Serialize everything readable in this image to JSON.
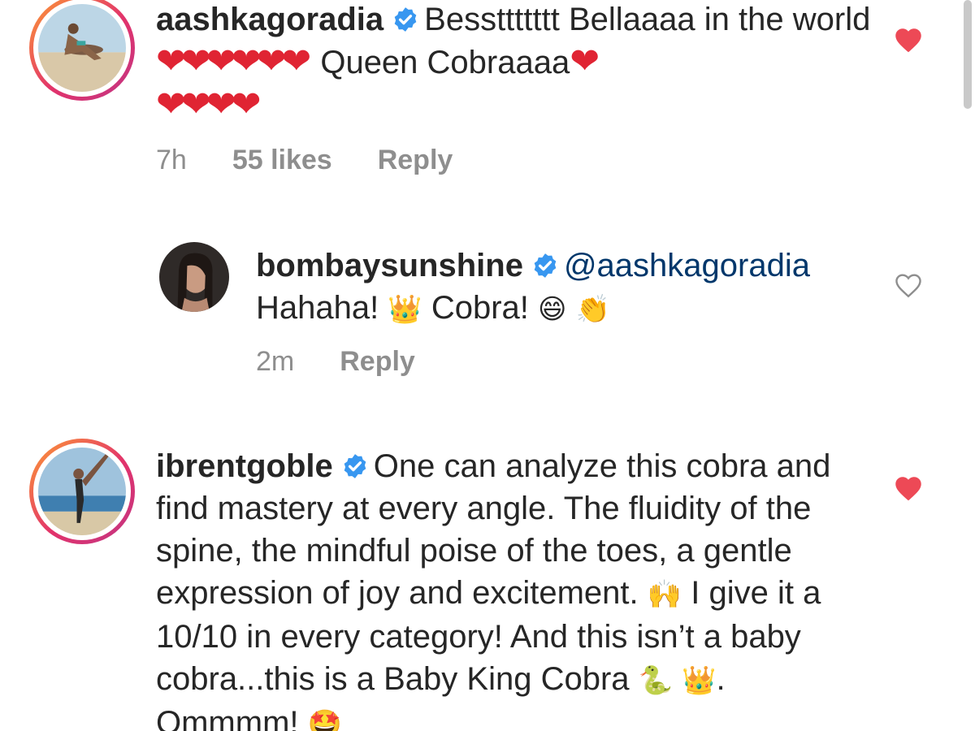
{
  "comments": [
    {
      "username": "aashkagoradia",
      "text_part1": "Bessttttttt Bellaaaa in the world",
      "hearts_a": "❤❤❤❤❤❤",
      "text_part2": "Queen Cobraaaa",
      "hearts_b": "❤",
      "hearts_c": "❤❤❤❤",
      "time": "7h",
      "likes": "55 likes",
      "reply": "Reply",
      "liked": true
    },
    {
      "username": "bombaysunshine",
      "mention": "@aashkagoradia",
      "text_part1": "Hahaha!",
      "emoji_crown": "👑",
      "text_part2": "Cobra!",
      "emoji_grin": "😄",
      "emoji_clap": "👏",
      "time": "2m",
      "reply": "Reply",
      "liked": false
    },
    {
      "username": "ibrentgoble",
      "text_part1": "One can analyze this cobra and find mastery at every angle. The fluidity of the spine, the mindful poise of the toes, a gentle expression of joy and excitement.",
      "emoji_hands": "🙌",
      "text_part2": "I give it a 10/10 in every category! And this isn’t a baby cobra...this is a Baby King Cobra",
      "emoji_snake": "🐍",
      "emoji_crown": "👑",
      "text_part3": ". Ommmm!",
      "emoji_starstruck": "🤩",
      "liked": true
    }
  ],
  "colors": {
    "text": "#262626",
    "meta": "#8e8e8e",
    "mention": "#00376b",
    "heart": "#ed4956",
    "verified": "#3897f0"
  },
  "icons": [
    "verified-badge-icon",
    "heart-icon",
    "heart-outline-icon"
  ]
}
